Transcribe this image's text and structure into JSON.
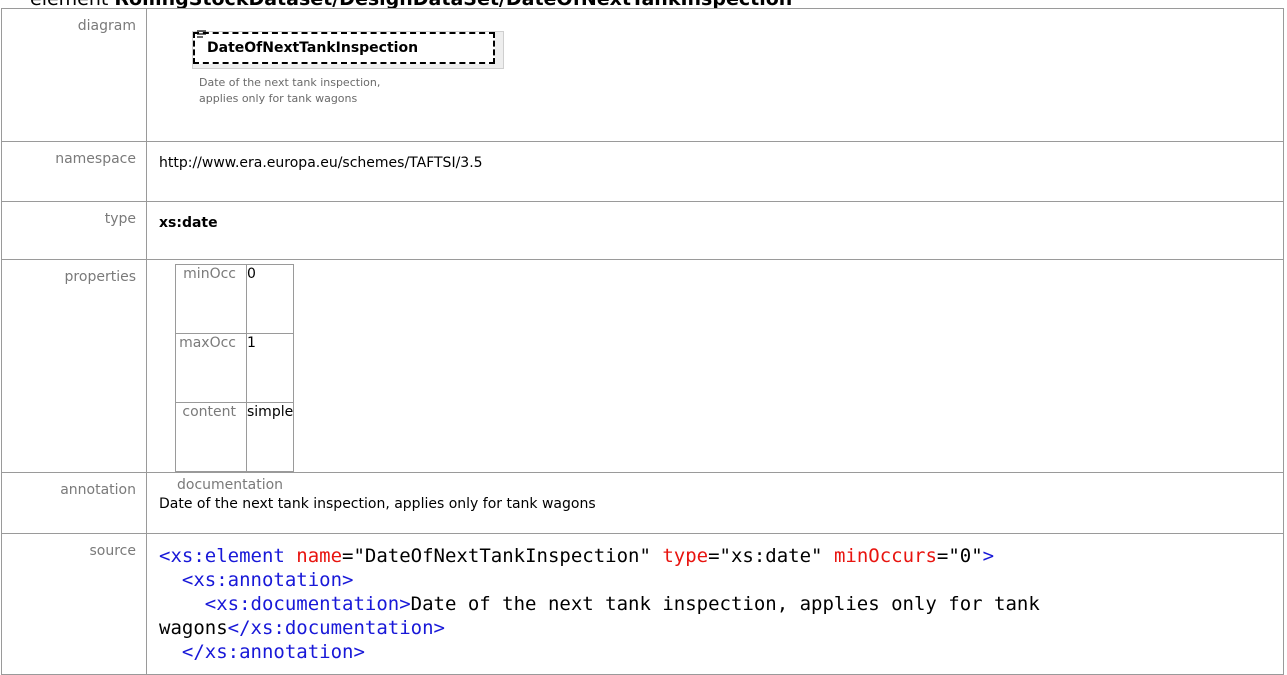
{
  "heading": {
    "prefix": "element ",
    "path": "RollingStockDataset/DesignDataSet/DateOfNextTankInspection"
  },
  "labels": {
    "diagram": "diagram",
    "namespace": "namespace",
    "type": "type",
    "properties": "properties",
    "annotation": "annotation",
    "source": "source"
  },
  "diagram": {
    "element_name": "DateOfNextTankInspection",
    "desc_line1": "Date of the next tank inspection,",
    "desc_line2": "applies only for tank wagons"
  },
  "namespace": "http://www.era.europa.eu/schemes/TAFTSI/3.5",
  "type": "xs:date",
  "properties": [
    {
      "key": "minOcc",
      "value": "0"
    },
    {
      "key": "maxOcc",
      "value": "1"
    },
    {
      "key": "content",
      "value": "simple"
    }
  ],
  "annotation": {
    "title": "documentation",
    "text": "Date of the next tank inspection, applies only for tank wagons"
  },
  "source": {
    "l1_tag_open": "<xs:element ",
    "l1_attr1": "name",
    "l1_val1": "=\"DateOfNextTankInspection\" ",
    "l1_attr2": "type",
    "l1_val2": "=\"xs:date\" ",
    "l1_attr3": "minOccurs",
    "l1_val3": "=\"0\"",
    "l1_close": ">",
    "l2": "  <xs:annotation>",
    "l3_open": "    <xs:documentation>",
    "l3_text": "Date of the next tank inspection, applies only for tank wagons",
    "l3_close": "</xs:documentation>",
    "l4": "  </xs:annotation>"
  },
  "colors": {
    "tag": "#1818d8",
    "attr": "#e8140f",
    "label": "#7a7a7a",
    "border": "#9a9a9a"
  }
}
